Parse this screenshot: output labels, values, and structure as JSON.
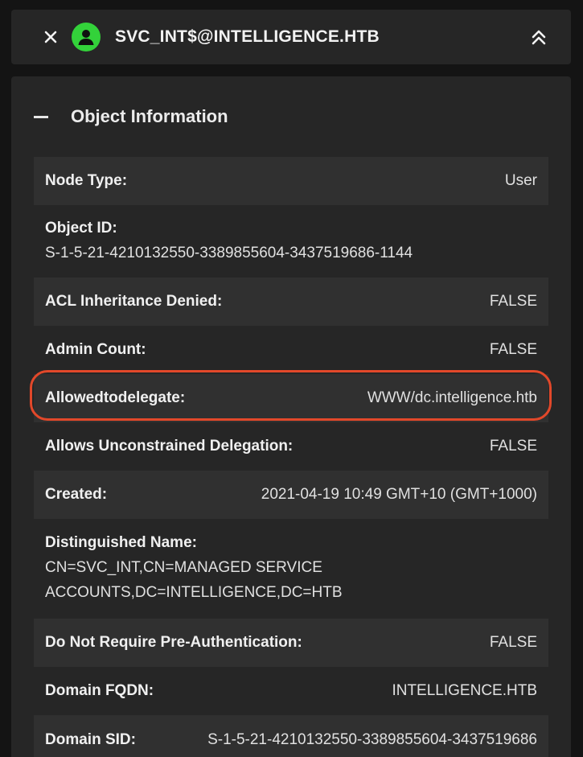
{
  "header": {
    "node_name": "SVC_INT$@INTELLIGENCE.HTB",
    "avatar_color": "#33d23a"
  },
  "section": {
    "title": "Object Information"
  },
  "rows": [
    {
      "label": "Node Type:",
      "value": "User"
    },
    {
      "label": "Object ID:",
      "value": "S-1-5-21-4210132550-3389855604-3437519686-1144"
    },
    {
      "label": "ACL Inheritance Denied:",
      "value": "FALSE"
    },
    {
      "label": "Admin Count:",
      "value": "FALSE"
    },
    {
      "label": "Allowedtodelegate:",
      "value": "WWW/dc.intelligence.htb"
    },
    {
      "label": "Allows Unconstrained Delegation:",
      "value": "FALSE"
    },
    {
      "label": "Created:",
      "value": "2021-04-19 10:49 GMT+10 (GMT+1000)"
    },
    {
      "label": "Distinguished Name:",
      "value": "CN=SVC_INT,CN=MANAGED SERVICE ACCOUNTS,DC=INTELLIGENCE,DC=HTB"
    },
    {
      "label": "Do Not Require Pre-Authentication:",
      "value": "FALSE"
    },
    {
      "label": "Domain FQDN:",
      "value": "INTELLIGENCE.HTB"
    },
    {
      "label": "Domain SID:",
      "value": "S-1-5-21-4210132550-3389855604-3437519686"
    }
  ],
  "highlight_color": "#e2482a"
}
